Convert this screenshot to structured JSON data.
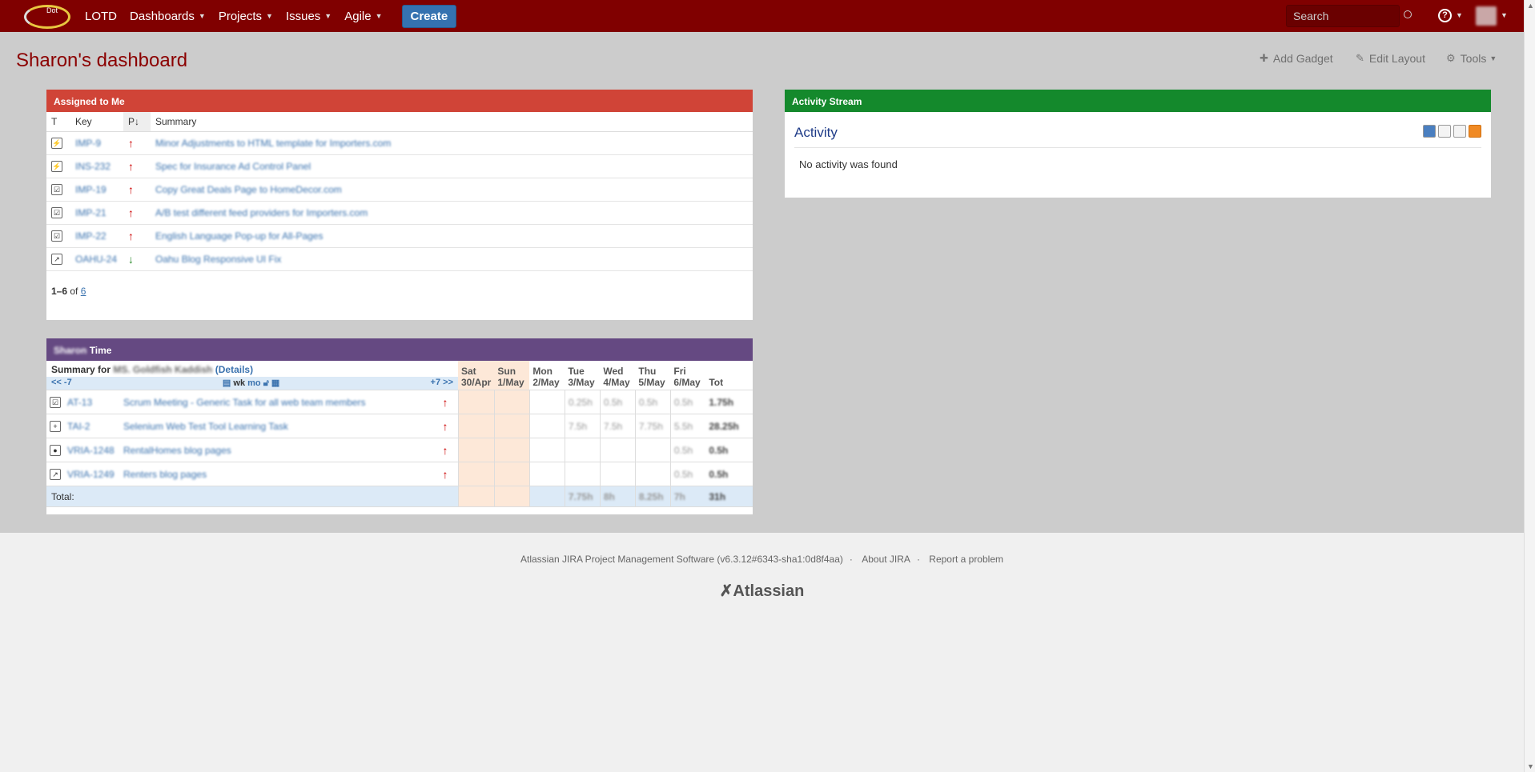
{
  "header": {
    "logo_text": "Dot",
    "home": "LOTD",
    "nav": [
      {
        "label": "Dashboards"
      },
      {
        "label": "Projects"
      },
      {
        "label": "Issues"
      },
      {
        "label": "Agile"
      }
    ],
    "create_label": "Create",
    "search_placeholder": "Search",
    "help_glyph": "?"
  },
  "page": {
    "title": "Sharon's dashboard",
    "tools": {
      "add_gadget": "Add Gadget",
      "edit_layout": "Edit Layout",
      "tools": "Tools"
    }
  },
  "assigned": {
    "title": "Assigned to Me",
    "headers": {
      "t": "T",
      "key": "Key",
      "p": "P",
      "summary": "Summary"
    },
    "rows": [
      {
        "type_icon": "improvement-icon",
        "type_glyph": "⚡",
        "key": "IMP-9",
        "priority": "up",
        "summary": "Minor Adjustments to HTML template for Importers.com"
      },
      {
        "type_icon": "improvement-icon",
        "type_glyph": "⚡",
        "key": "INS-232",
        "priority": "up",
        "summary": "Spec for Insurance Ad Control Panel"
      },
      {
        "type_icon": "task-icon",
        "type_glyph": "☑",
        "key": "IMP-19",
        "priority": "up",
        "summary": "Copy Great Deals Page to HomeDecor.com"
      },
      {
        "type_icon": "task-icon",
        "type_glyph": "☑",
        "key": "IMP-21",
        "priority": "up",
        "summary": "A/B test different feed providers for Importers.com"
      },
      {
        "type_icon": "task-icon",
        "type_glyph": "☑",
        "key": "IMP-22",
        "priority": "up",
        "summary": "English Language Pop-up for All-Pages"
      },
      {
        "type_icon": "subtask-icon",
        "type_glyph": "↗",
        "key": "OAHU-24",
        "priority": "down",
        "summary": "Oahu Blog Responsive UI Fix"
      }
    ],
    "paging": {
      "range": "1–6",
      "of": "of",
      "total": "6"
    }
  },
  "activity": {
    "title": "Activity Stream",
    "heading": "Activity",
    "empty": "No activity was found"
  },
  "time": {
    "title_name": "Sharon",
    "title": "Time",
    "summary_for": "Summary for",
    "summary_name": "MS. Goldfish Kaddish",
    "details": "(Details)",
    "nav": {
      "prev": "<<",
      "minus": "-7",
      "wk": "wk",
      "mo": "mo",
      "plus": "+7",
      "next": ">>"
    },
    "days": [
      {
        "day": "Sat",
        "date": "30/Apr",
        "weekend": true
      },
      {
        "day": "Sun",
        "date": "1/May",
        "weekend": true
      },
      {
        "day": "Mon",
        "date": "2/May",
        "weekend": false
      },
      {
        "day": "Tue",
        "date": "3/May",
        "weekend": false
      },
      {
        "day": "Wed",
        "date": "4/May",
        "weekend": false
      },
      {
        "day": "Thu",
        "date": "5/May",
        "weekend": false
      },
      {
        "day": "Fri",
        "date": "6/May",
        "weekend": false
      }
    ],
    "tot_label": "Tot",
    "rows": [
      {
        "type_glyph": "☑",
        "key": "AT-13",
        "summary": "Scrum Meeting - Generic Task for all web team members",
        "hours": [
          "",
          "",
          "",
          "0.25h",
          "0.5h",
          "0.5h",
          "0.5h"
        ],
        "total": "1.75h"
      },
      {
        "type_glyph": "+",
        "key": "TAI-2",
        "summary": "Selenium Web Test Tool Learning Task",
        "hours": [
          "",
          "",
          "",
          "7.5h",
          "7.5h",
          "7.75h",
          "5.5h"
        ],
        "total": "28.25h"
      },
      {
        "type_glyph": "●",
        "key": "VRIA-1248",
        "summary": "RentalHomes blog pages",
        "hours": [
          "",
          "",
          "",
          "",
          "",
          "",
          "0.5h"
        ],
        "total": "0.5h"
      },
      {
        "type_glyph": "↗",
        "key": "VRIA-1249",
        "summary": "Renters blog pages",
        "hours": [
          "",
          "",
          "",
          "",
          "",
          "",
          "0.5h"
        ],
        "total": "0.5h"
      }
    ],
    "total_label": "Total:",
    "totals": [
      "",
      "",
      "",
      "7.75h",
      "8h",
      "8.25h",
      "7h"
    ],
    "grand_total": "31h"
  },
  "footer": {
    "version": "Atlassian JIRA Project Management Software (v6.3.12#6343-sha1:0d8f4aa)",
    "about": "About JIRA",
    "report": "Report a problem",
    "logo": "Atlassian"
  }
}
